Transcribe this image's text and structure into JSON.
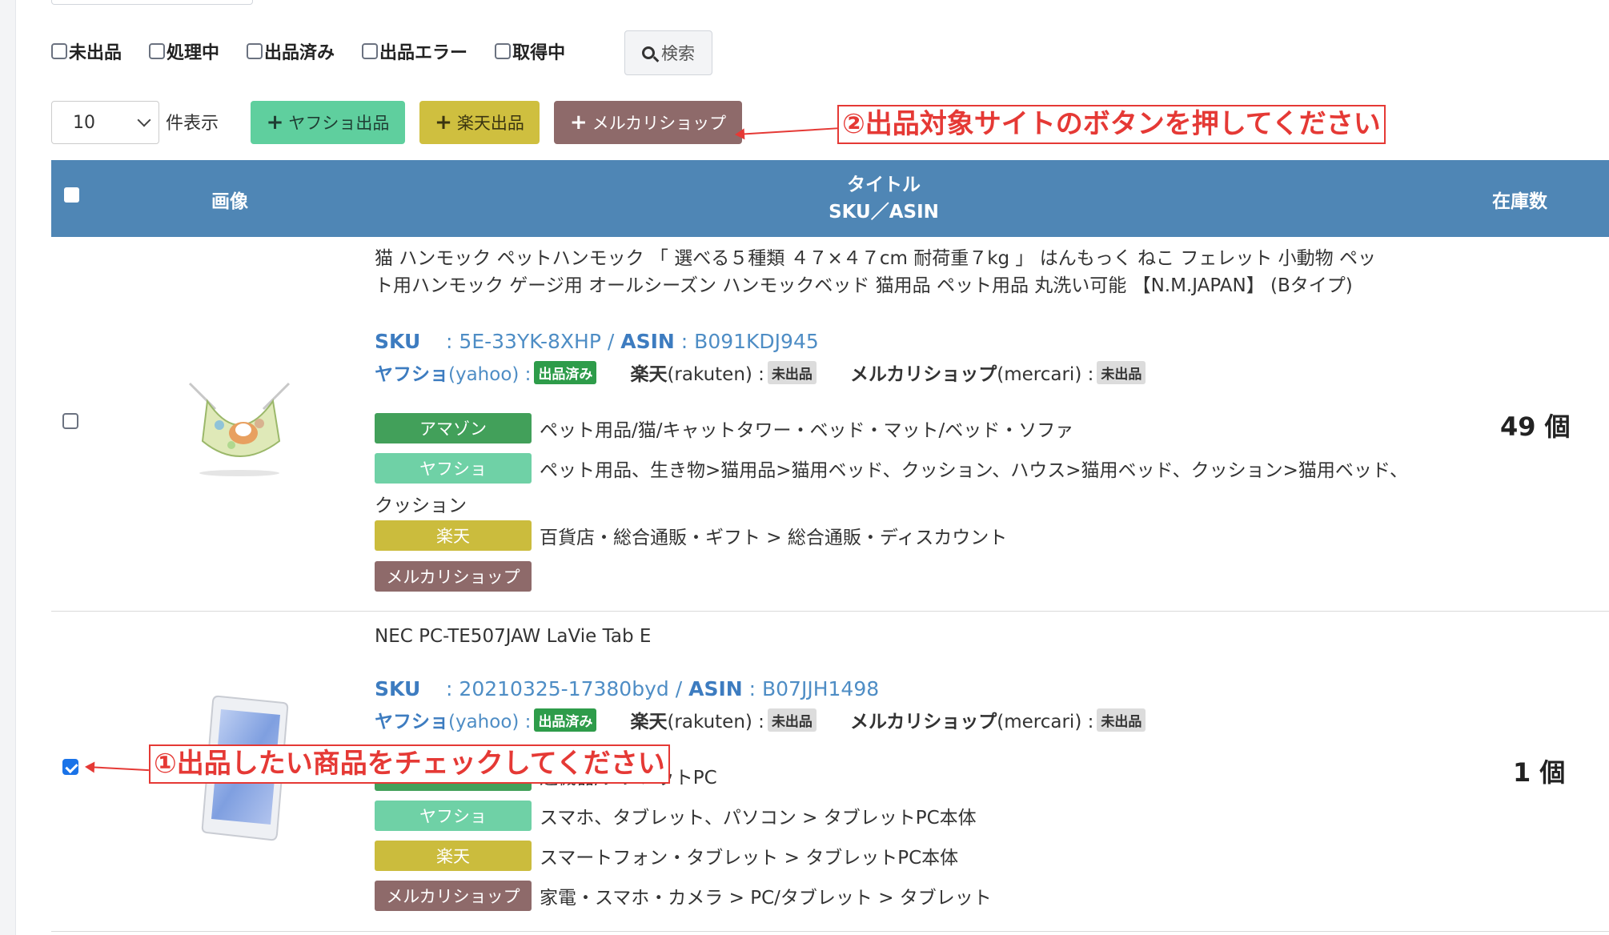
{
  "filters": [
    {
      "label": "未出品",
      "checked": false
    },
    {
      "label": "処理中",
      "checked": false
    },
    {
      "label": "出品済み",
      "checked": false
    },
    {
      "label": "出品エラー",
      "checked": false
    },
    {
      "label": "取得中",
      "checked": false
    }
  ],
  "search_label": "検索",
  "per_page": {
    "value": "10",
    "label": "件表示"
  },
  "actions": {
    "yahoo": "ヤフショ出品",
    "rakuten": "楽天出品",
    "mercari": "メルカリショップ"
  },
  "annotations": {
    "step2": "②出品対象サイトのボタンを押してください",
    "step1": "①出品したい商品をチェックしてください"
  },
  "table": {
    "headers": {
      "image": "画像",
      "title_line1": "タイトル",
      "title_line2": "SKU／ASIN",
      "stock": "在庫数"
    }
  },
  "labels": {
    "sku": "SKU",
    "asin": "ASIN",
    "yahoo_site": "ヤフショ",
    "yahoo_en": "(yahoo)",
    "rakuten_site": "楽天",
    "rakuten_en": "(rakuten)",
    "mercari_site": "メルカリショップ",
    "mercari_en": "(mercari)",
    "tag_amazon": "アマゾン",
    "tag_yahoo": "ヤフショ",
    "tag_rakuten": "楽天",
    "tag_mercari": "メルカリショップ"
  },
  "products": [
    {
      "checked": false,
      "title_line1": "猫 ハンモック ペットハンモック 「 選べる５種類 ４７×４７cm 耐荷重７kg 」 はんもっく ねこ フェレット 小動物 ペッ",
      "title_line2": "ト用ハンモック ゲージ用 オールシーズン ハンモックベッド 猫用品 ペット用品 丸洗い可能 【N.M.JAPAN】 (Bタイプ)",
      "sku": "5E-33YK-8XHP",
      "asin": "B091KDJ945",
      "status_yahoo": "出品済み",
      "status_rakuten": "未出品",
      "status_mercari": "未出品",
      "cat_amazon": "ペット用品/猫/キャットタワー・ベッド・マット/ベッド・ソファ",
      "cat_yahoo": "ペット用品、生き物>猫用品>猫用ベッド、クッション、ハウス>猫用ベッド、クッション>猫用ベッド、",
      "cat_yahoo_cont": "クッション",
      "cat_rakuten": "百貨店・総合通販・ギフト > 総合通販・ディスカウント",
      "cat_mercari": "",
      "stock": "49 個"
    },
    {
      "checked": true,
      "title_line1": "NEC PC-TE507JAW LaVie Tab E",
      "sku": "20210325-17380byd",
      "asin": "B07JJH1498",
      "status_yahoo": "出品済み",
      "status_rakuten": "未出品",
      "status_mercari": "未出品",
      "cat_amazon": "辺機器/タブレットPC",
      "cat_yahoo": "スマホ、タブレット、パソコン > タブレットPC本体",
      "cat_rakuten": "スマートフォン・タブレット > タブレットPC本体",
      "cat_mercari": "家電・スマホ・カメラ > PC/タブレット > タブレット",
      "stock": "1 個"
    }
  ],
  "colors": {
    "header": "#4f86b5",
    "yahoo": "#5fcf9e",
    "rakuten": "#cfbf3f",
    "mercari": "#8e6a6a",
    "amazon": "#42a05a",
    "annotation": "#e53935",
    "link": "#4e8dc5"
  }
}
